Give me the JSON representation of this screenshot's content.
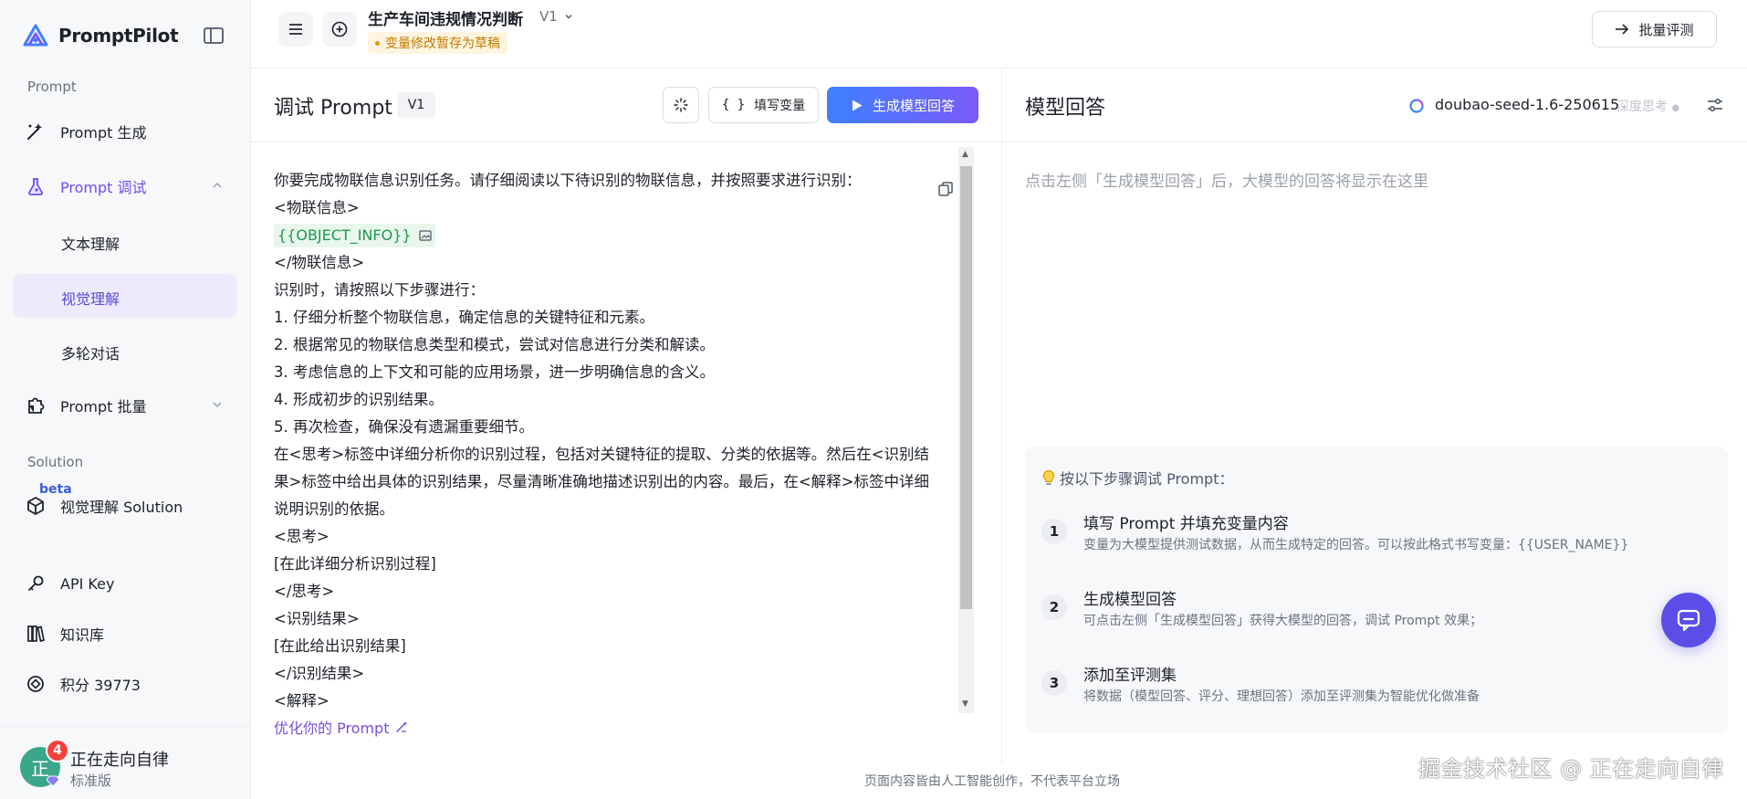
{
  "app": {
    "brand": "PromptPilot",
    "accent": "#6f4cf5",
    "button_gradient": [
      "#3f80ff",
      "#7a5af8"
    ]
  },
  "sidebar": {
    "section_prompt": "Prompt",
    "items": [
      {
        "label": "Prompt 生成",
        "icon": "magic-wand-icon"
      },
      {
        "label": "Prompt 调试",
        "icon": "flask-icon",
        "expanded": true
      },
      {
        "label": "Prompt 批量",
        "icon": "puzzle-icon",
        "expanded": false
      }
    ],
    "subitems": [
      {
        "label": "文本理解"
      },
      {
        "label": "视觉理解",
        "selected": true
      },
      {
        "label": "多轮对话"
      }
    ],
    "section_solution": "Solution",
    "solution_item": {
      "label": "视觉理解 Solution",
      "badge": "beta",
      "icon": "cube-icon"
    },
    "bottom_items": [
      {
        "label": "API Key",
        "icon": "key-icon"
      },
      {
        "label": "知识库",
        "icon": "books-icon"
      },
      {
        "label": "积分 39773",
        "icon": "coin-icon"
      }
    ],
    "user": {
      "avatar_char": "正",
      "name": "正在走向自律",
      "plan": "标准版",
      "notifications": "4"
    }
  },
  "header": {
    "title": "生产车间违规情况判断",
    "version": "V1",
    "draft_notice": "变量修改暂存为草稿",
    "batch_button": "批量评测"
  },
  "debug": {
    "title": "调试 Prompt",
    "version": "V1",
    "fill_vars_button": "填写变量",
    "generate_button": "生成模型回答",
    "lines": [
      "你要完成物联信息识别任务。请仔细阅读以下待识别的物联信息，并按照要求进行识别：",
      "<物联信息>",
      "{{OBJECT_INFO}}",
      "</物联信息>",
      "识别时，请按照以下步骤进行：",
      "1. 仔细分析整个物联信息，确定信息的关键特征和元素。",
      "2. 根据常见的物联信息类型和模式，尝试对信息进行分类和解读。",
      "3. 考虑信息的上下文和可能的应用场景，进一步明确信息的含义。",
      "4. 形成初步的识别结果。",
      "5. 再次检查，确保没有遗漏重要细节。",
      "在<思考>标签中详细分析你的识别过程，包括对关键特征的提取、分类的依据等。然后在<识别结果>标签中给出具体的识别结果，尽量清晰准确地描述识别出的内容。最后，在<解释>标签中详细说明识别的依据。",
      "<思考>",
      "[在此详细分析识别过程]",
      "</思考>",
      "<识别结果>",
      "[在此给出识别结果]",
      "</识别结果>",
      "<解释>"
    ],
    "variable_chip": "{{OBJECT_INFO}}",
    "optimize_link": "优化你的 Prompt"
  },
  "response": {
    "title": "模型回答",
    "model": "doubao-seed-1.6-250615",
    "deep_think": "深度思考",
    "placeholder": "点击左侧「生成模型回答」后，大模型的回答将显示在这里",
    "guide_title": "按以下步骤调试 Prompt：",
    "steps": [
      {
        "num": "1",
        "title": "填写 Prompt 并填充变量内容",
        "desc": "变量为大模型提供测试数据，从而生成特定的回答。可以按此格式书写变量：{{USER_NAME}}"
      },
      {
        "num": "2",
        "title": "生成模型回答",
        "desc": "可点击左侧「生成模型回答」获得大模型的回答，调试 Prompt 效果；"
      },
      {
        "num": "3",
        "title": "添加至评测集",
        "desc": "将数据（模型回答、评分、理想回答）添加至评测集为智能优化做准备"
      }
    ]
  },
  "footer": {
    "disclaimer": "页面内容皆由人工智能创作，不代表平台立场",
    "watermark": "掘金技术社区 @ 正在走向自律"
  }
}
